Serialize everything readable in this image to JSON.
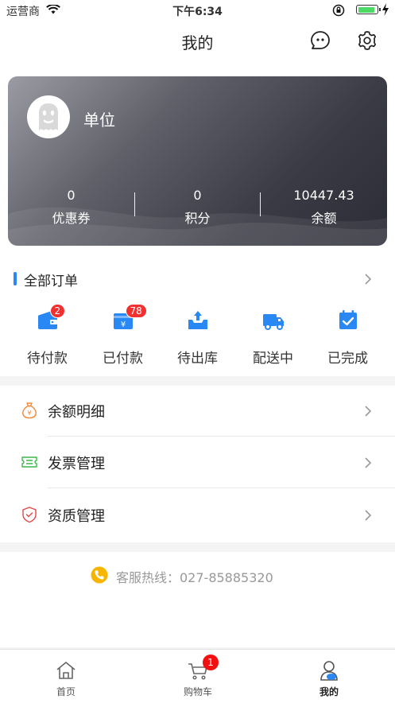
{
  "status_bar": {
    "carrier": "运营商",
    "time": "下午6:34"
  },
  "nav": {
    "title": "我的"
  },
  "account_card": {
    "name": "单位",
    "stats": [
      {
        "value": "0",
        "label": "优惠券"
      },
      {
        "value": "0",
        "label": "积分"
      },
      {
        "value": "10447.43",
        "label": "余额"
      }
    ]
  },
  "orders": {
    "title": "全部订单",
    "items": [
      {
        "label": "待付款",
        "badge": "2",
        "icon": "wallet-icon"
      },
      {
        "label": "已付款",
        "badge": "78",
        "icon": "paid-card-icon"
      },
      {
        "label": "待出库",
        "badge": "",
        "icon": "outbound-box-icon"
      },
      {
        "label": "配送中",
        "badge": "",
        "icon": "delivery-truck-icon"
      },
      {
        "label": "已完成",
        "badge": "",
        "icon": "calendar-check-icon"
      }
    ]
  },
  "menu": {
    "items": [
      {
        "label": "余额明细",
        "icon": "money-bag-icon",
        "color": "#f08a3c"
      },
      {
        "label": "发票管理",
        "icon": "ticket-icon",
        "color": "#3cb84a"
      },
      {
        "label": "资质管理",
        "icon": "shield-icon",
        "color": "#e64545"
      }
    ]
  },
  "hotline": {
    "text": "客服热线：027-85885320",
    "color": "#f7b500"
  },
  "tabbar": {
    "items": [
      {
        "label": "首页",
        "icon": "home-icon"
      },
      {
        "label": "购物车",
        "icon": "cart-icon",
        "badge": "1"
      },
      {
        "label": "我的",
        "icon": "profile-icon",
        "active": true
      }
    ]
  },
  "colors": {
    "accent": "#2a88f5",
    "badge": "#f23030"
  }
}
